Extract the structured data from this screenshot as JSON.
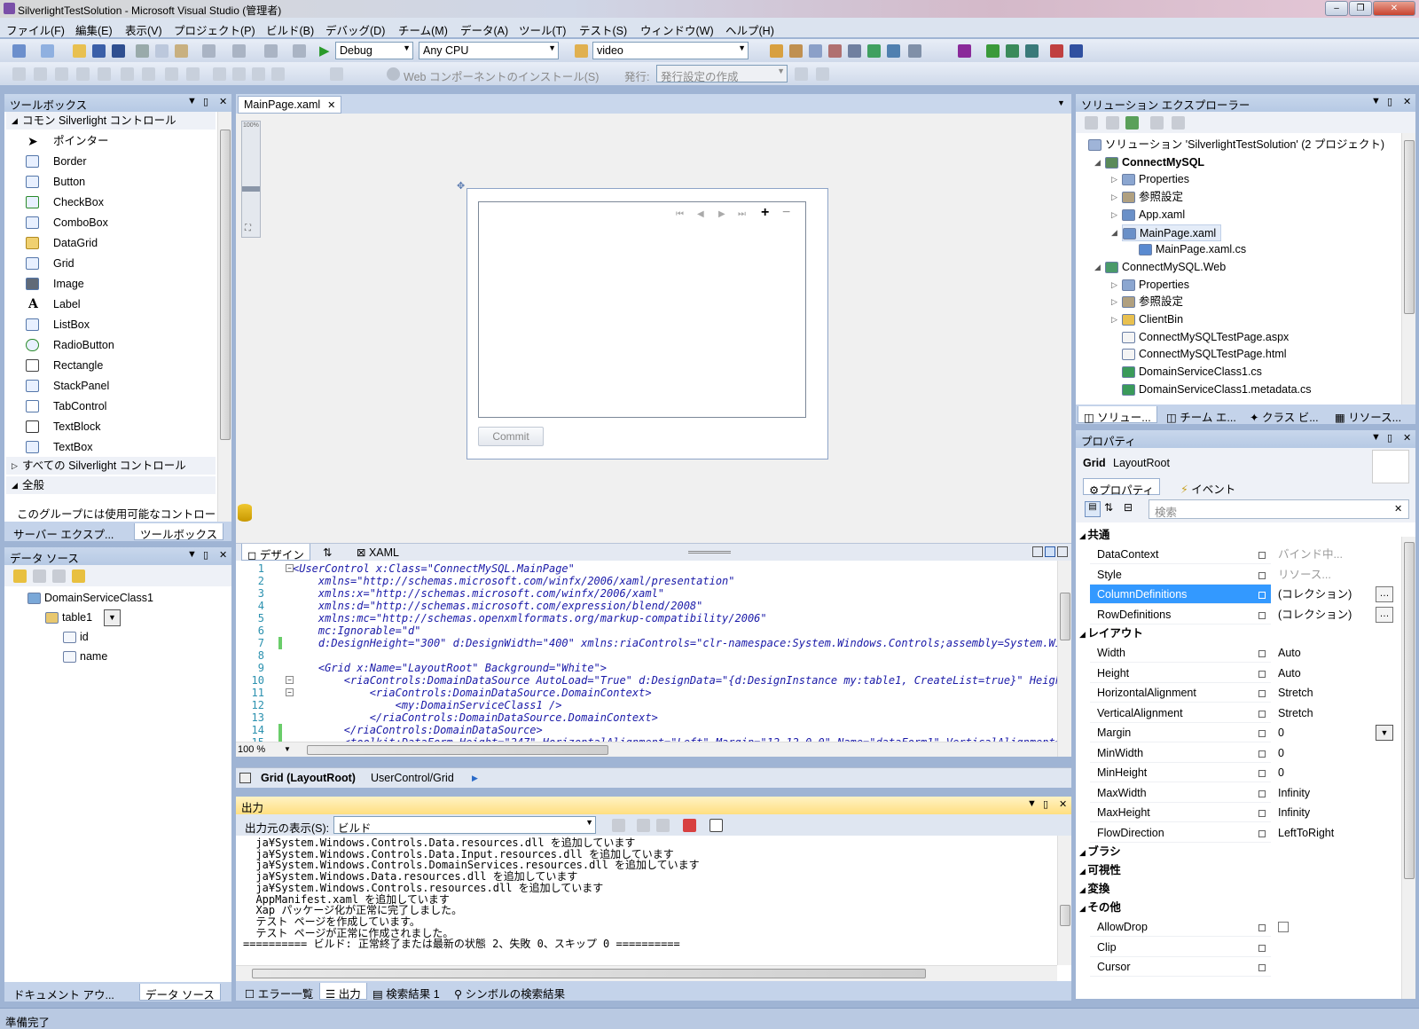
{
  "window": {
    "title": "SilverlightTestSolution - Microsoft Visual Studio (管理者)"
  },
  "menu": [
    "ファイル(F)",
    "編集(E)",
    "表示(V)",
    "プロジェクト(P)",
    "ビルド(B)",
    "デバッグ(D)",
    "チーム(M)",
    "データ(A)",
    "ツール(T)",
    "テスト(S)",
    "ウィンドウ(W)",
    "ヘルプ(H)"
  ],
  "toolbar": {
    "config": "Debug",
    "platform": "Any CPU",
    "find": "video",
    "web_install": "Web コンポーネントのインストール(S)",
    "publish_label": "発行:",
    "publish_setting": "発行設定の作成"
  },
  "toolbox": {
    "title": "ツールボックス",
    "section_common": "コモン Silverlight コントロール",
    "items": [
      "ポインター",
      "Border",
      "Button",
      "CheckBox",
      "ComboBox",
      "DataGrid",
      "Grid",
      "Image",
      "Label",
      "ListBox",
      "RadioButton",
      "Rectangle",
      "StackPanel",
      "TabControl",
      "TextBlock",
      "TextBox"
    ],
    "section_all": "すべての Silverlight コントロール",
    "section_general": "全般",
    "empty_note": "このグループには使用可能なコントロー",
    "tab_server": "サーバー エクスプ...",
    "tab_toolbox": "ツールボックス"
  },
  "datasource": {
    "title": "データ ソース",
    "root": "DomainServiceClass1",
    "table": "table1",
    "fields": [
      "id",
      "name"
    ],
    "tab_doc": "ドキュメント アウ...",
    "tab_ds": "データ ソース"
  },
  "editor": {
    "tab": "MainPage.xaml",
    "zoom_level": "100%",
    "commit": "Commit",
    "design_tab": "デザイン",
    "swap_icon": "⇅",
    "xaml_tab": "XAML",
    "zoom": "100 %",
    "code": [
      {
        "n": "1",
        "t": "<UserControl x:Class=\"ConnectMySQL.MainPage\""
      },
      {
        "n": "2",
        "t": "    xmlns=\"http://schemas.microsoft.com/winfx/2006/xaml/presentation\""
      },
      {
        "n": "3",
        "t": "    xmlns:x=\"http://schemas.microsoft.com/winfx/2006/xaml\""
      },
      {
        "n": "4",
        "t": "    xmlns:d=\"http://schemas.microsoft.com/expression/blend/2008\""
      },
      {
        "n": "5",
        "t": "    xmlns:mc=\"http://schemas.openxmlformats.org/markup-compatibility/2006\""
      },
      {
        "n": "6",
        "t": "    mc:Ignorable=\"d\""
      },
      {
        "n": "7",
        "t": "    d:DesignHeight=\"300\" d:DesignWidth=\"400\" xmlns:riaControls=\"clr-namespace:System.Windows.Controls;assembly=System.Wind"
      },
      {
        "n": "8",
        "t": ""
      },
      {
        "n": "9",
        "t": "    <Grid x:Name=\"LayoutRoot\" Background=\"White\">"
      },
      {
        "n": "10",
        "t": "        <riaControls:DomainDataSource AutoLoad=\"True\" d:DesignData=\"{d:DesignInstance my:table1, CreateList=true}\" Height="
      },
      {
        "n": "11",
        "t": "            <riaControls:DomainDataSource.DomainContext>"
      },
      {
        "n": "12",
        "t": "                <my:DomainServiceClass1 />"
      },
      {
        "n": "13",
        "t": "            </riaControls:DomainDataSource.DomainContext>"
      },
      {
        "n": "14",
        "t": "        </riaControls:DomainDataSource>"
      },
      {
        "n": "15",
        "t": "        <toolkit:DataForm Height=\"247\" HorizontalAlignment=\"Left\" Margin=\"12,12,0,0\" Name=\"dataForm1\" VerticalAlignment=\"T"
      }
    ],
    "breadcrumb_bold": "Grid (LayoutRoot)",
    "breadcrumb_path": "UserControl/Grid"
  },
  "output": {
    "title": "出力",
    "source_label": "出力元の表示(S):",
    "source_value": "ビルド",
    "lines": [
      "  ja¥System.Windows.Controls.Data.resources.dll を追加しています",
      "  ja¥System.Windows.Controls.Data.Input.resources.dll を追加しています",
      "  ja¥System.Windows.Controls.DomainServices.resources.dll を追加しています",
      "  ja¥System.Windows.Data.resources.dll を追加しています",
      "  ja¥System.Windows.Controls.resources.dll を追加しています",
      "  AppManifest.xaml を追加しています",
      "  Xap パッケージ化が正常に完了しました。",
      "  テスト ページを作成しています。",
      "  テスト ページが正常に作成されました。",
      "========== ビルド: 正常終了または最新の状態 2、失敗 0、スキップ 0 =========="
    ],
    "tabs": [
      "エラー一覧",
      "出力",
      "検索結果 1",
      "シンボルの検索結果"
    ]
  },
  "solution": {
    "title": "ソリューション エクスプローラー",
    "nodes": [
      {
        "label": "ソリューション 'SilverlightTestSolution' (2 プロジェクト)",
        "level": 0,
        "bold": false
      },
      {
        "label": "ConnectMySQL",
        "level": 1,
        "bold": true
      },
      {
        "label": "Properties",
        "level": 2,
        "bold": false
      },
      {
        "label": "参照設定",
        "level": 2,
        "bold": false
      },
      {
        "label": "App.xaml",
        "level": 2,
        "bold": false
      },
      {
        "label": "MainPage.xaml",
        "level": 2,
        "bold": false
      },
      {
        "label": "MainPage.xaml.cs",
        "level": 3,
        "bold": false
      },
      {
        "label": "ConnectMySQL.Web",
        "level": 1,
        "bold": false
      },
      {
        "label": "Properties",
        "level": 2,
        "bold": false
      },
      {
        "label": "参照設定",
        "level": 2,
        "bold": false
      },
      {
        "label": "ClientBin",
        "level": 2,
        "bold": false
      },
      {
        "label": "ConnectMySQLTestPage.aspx",
        "level": 2,
        "bold": false
      },
      {
        "label": "ConnectMySQLTestPage.html",
        "level": 2,
        "bold": false
      },
      {
        "label": "DomainServiceClass1.cs",
        "level": 2,
        "bold": false
      },
      {
        "label": "DomainServiceClass1.metadata.cs",
        "level": 2,
        "bold": false
      }
    ],
    "tabs": [
      "ソリュー...",
      "チーム エ...",
      "クラス ビ...",
      "リソース..."
    ]
  },
  "properties": {
    "title": "プロパティ",
    "type": "Grid",
    "name": "LayoutRoot",
    "tab_props": "プロパティ",
    "tab_events": "イベント",
    "search_placeholder": "検索",
    "cat_common": "共通",
    "cat_layout": "レイアウト",
    "cat_brush": "ブラシ",
    "cat_visibility": "可視性",
    "cat_transform": "変換",
    "cat_other": "その他",
    "common": [
      {
        "k": "DataContext",
        "v": "バインド中..."
      },
      {
        "k": "Style",
        "v": "リソース..."
      },
      {
        "k": "ColumnDefinitions",
        "v": "(コレクション)"
      },
      {
        "k": "RowDefinitions",
        "v": "(コレクション)"
      }
    ],
    "layout": [
      {
        "k": "Width",
        "v": "Auto"
      },
      {
        "k": "Height",
        "v": "Auto"
      },
      {
        "k": "HorizontalAlignment",
        "v": "Stretch"
      },
      {
        "k": "VerticalAlignment",
        "v": "Stretch"
      },
      {
        "k": "Margin",
        "v": "0"
      },
      {
        "k": "MinWidth",
        "v": "0"
      },
      {
        "k": "MinHeight",
        "v": "0"
      },
      {
        "k": "MaxWidth",
        "v": "Infinity"
      },
      {
        "k": "MaxHeight",
        "v": "Infinity"
      },
      {
        "k": "FlowDirection",
        "v": "LeftToRight"
      }
    ],
    "other": [
      {
        "k": "AllowDrop",
        "v": ""
      },
      {
        "k": "Clip",
        "v": ""
      },
      {
        "k": "Cursor",
        "v": ""
      }
    ]
  },
  "status": {
    "text": "準備完了"
  }
}
